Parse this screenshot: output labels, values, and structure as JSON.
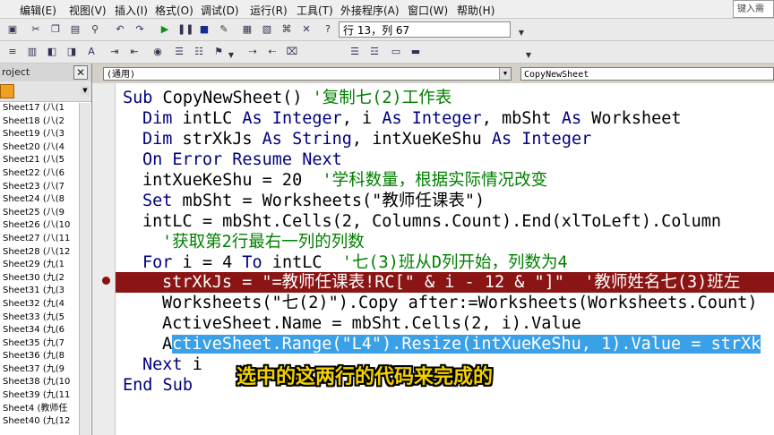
{
  "menu": [
    "编辑(E)",
    "视图(V)",
    "插入(I)",
    "格式(O)",
    "调试(D)",
    "运行(R)",
    "工具(T)",
    "外接程序(A)",
    "窗口(W)",
    "帮助(H)"
  ],
  "help_search": "键入需",
  "toolbar": {
    "position": "行 13，列 67"
  },
  "project": {
    "title": "roject",
    "close": "✕",
    "items": [
      "Sheet17 (八(1",
      "Sheet18 (八(2",
      "Sheet19 (八(3",
      "Sheet20 (八(4",
      "Sheet21 (八(5",
      "Sheet22 (八(6",
      "Sheet23 (八(7",
      "Sheet24 (八(8",
      "Sheet25 (八(9",
      "Sheet26 (八(10",
      "Sheet27 (八(11",
      "Sheet28 (八(12",
      "Sheet29 (九(1",
      "Sheet30 (九(2",
      "Sheet31 (九(3",
      "Sheet32 (九(4",
      "Sheet33 (九(5",
      "Sheet34 (九(6",
      "Sheet35 (九(7",
      "Sheet36 (九(8",
      "Sheet37 (九(9",
      "Sheet38 (九(10",
      "Sheet39 (九(11",
      "Sheet4 (教师任",
      "Sheet40 (九(12"
    ]
  },
  "code_window": {
    "object_combo": "(通用)",
    "proc_combo": "CopyNewSheet"
  },
  "code": {
    "l1_kw": "Sub",
    "l1_rest": " CopyNewSheet() ",
    "l1_cm": "'复制七(2)工作表",
    "l2_kw1": "Dim",
    "l2_t1": " intLC ",
    "l2_kw2": "As Integer",
    "l2_t2": ", i ",
    "l2_kw3": "As Integer",
    "l2_t3": ", mbSht ",
    "l2_kw4": "As",
    "l2_t4": " Worksheet",
    "l3_kw1": "Dim",
    "l3_t1": " strXkJs ",
    "l3_kw2": "As String",
    "l3_t2": ", intXueKeShu ",
    "l3_kw3": "As Integer",
    "l4_kw": "On Error Resume Next",
    "l5_t": "intXueKeShu = 20  ",
    "l5_cm": "'学科数量，根据实际情况改变",
    "l6_kw": "Set",
    "l6_t": " mbSht = Worksheets(\"教师任课表\")",
    "l7_t": "intLC = mbSht.Cells(2, Columns.Count).End(xlToLeft).Column",
    "l8_cm": "'获取第2行最右一列的列数",
    "l9_kw1": "For",
    "l9_t1": " i = 4 ",
    "l9_kw2": "To",
    "l9_t2": " intLC  ",
    "l9_cm": "'七(3)班从D列开始，列数为4",
    "l10_t": "strXkJs = \"=教师任课表!RC[\" & i - 12 & \"]\"  '教师姓名七(3)班左",
    "l11_t": "Worksheets(\"七(2)\").Copy after:=Worksheets(Worksheets.Count)",
    "l12_t": "ActiveSheet.Name = mbSht.Cells(2, i).Value",
    "l13_a": "A",
    "l13_sel": "ctiveSheet.Range(\"L4\").Resize(intXueKeShu, 1).Value = strXk",
    "l14_kw": "Next",
    "l14_t": " i",
    "l15_kw": "End Sub"
  },
  "subtitle": "选中的这两行的代码来完成的"
}
